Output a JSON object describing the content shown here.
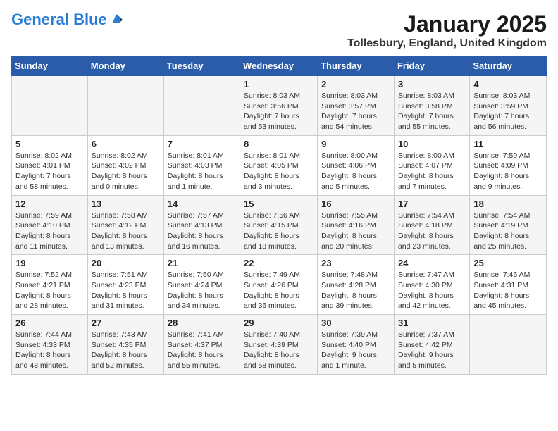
{
  "logo": {
    "general": "General",
    "blue": "Blue",
    "tagline": ""
  },
  "title": "January 2025",
  "location": "Tollesbury, England, United Kingdom",
  "days_header": [
    "Sunday",
    "Monday",
    "Tuesday",
    "Wednesday",
    "Thursday",
    "Friday",
    "Saturday"
  ],
  "weeks": [
    [
      {
        "num": "",
        "info": ""
      },
      {
        "num": "",
        "info": ""
      },
      {
        "num": "",
        "info": ""
      },
      {
        "num": "1",
        "info": "Sunrise: 8:03 AM\nSunset: 3:56 PM\nDaylight: 7 hours and 53 minutes."
      },
      {
        "num": "2",
        "info": "Sunrise: 8:03 AM\nSunset: 3:57 PM\nDaylight: 7 hours and 54 minutes."
      },
      {
        "num": "3",
        "info": "Sunrise: 8:03 AM\nSunset: 3:58 PM\nDaylight: 7 hours and 55 minutes."
      },
      {
        "num": "4",
        "info": "Sunrise: 8:03 AM\nSunset: 3:59 PM\nDaylight: 7 hours and 56 minutes."
      }
    ],
    [
      {
        "num": "5",
        "info": "Sunrise: 8:02 AM\nSunset: 4:01 PM\nDaylight: 7 hours and 58 minutes."
      },
      {
        "num": "6",
        "info": "Sunrise: 8:02 AM\nSunset: 4:02 PM\nDaylight: 8 hours and 0 minutes."
      },
      {
        "num": "7",
        "info": "Sunrise: 8:01 AM\nSunset: 4:03 PM\nDaylight: 8 hours and 1 minute."
      },
      {
        "num": "8",
        "info": "Sunrise: 8:01 AM\nSunset: 4:05 PM\nDaylight: 8 hours and 3 minutes."
      },
      {
        "num": "9",
        "info": "Sunrise: 8:00 AM\nSunset: 4:06 PM\nDaylight: 8 hours and 5 minutes."
      },
      {
        "num": "10",
        "info": "Sunrise: 8:00 AM\nSunset: 4:07 PM\nDaylight: 8 hours and 7 minutes."
      },
      {
        "num": "11",
        "info": "Sunrise: 7:59 AM\nSunset: 4:09 PM\nDaylight: 8 hours and 9 minutes."
      }
    ],
    [
      {
        "num": "12",
        "info": "Sunrise: 7:59 AM\nSunset: 4:10 PM\nDaylight: 8 hours and 11 minutes."
      },
      {
        "num": "13",
        "info": "Sunrise: 7:58 AM\nSunset: 4:12 PM\nDaylight: 8 hours and 13 minutes."
      },
      {
        "num": "14",
        "info": "Sunrise: 7:57 AM\nSunset: 4:13 PM\nDaylight: 8 hours and 16 minutes."
      },
      {
        "num": "15",
        "info": "Sunrise: 7:56 AM\nSunset: 4:15 PM\nDaylight: 8 hours and 18 minutes."
      },
      {
        "num": "16",
        "info": "Sunrise: 7:55 AM\nSunset: 4:16 PM\nDaylight: 8 hours and 20 minutes."
      },
      {
        "num": "17",
        "info": "Sunrise: 7:54 AM\nSunset: 4:18 PM\nDaylight: 8 hours and 23 minutes."
      },
      {
        "num": "18",
        "info": "Sunrise: 7:54 AM\nSunset: 4:19 PM\nDaylight: 8 hours and 25 minutes."
      }
    ],
    [
      {
        "num": "19",
        "info": "Sunrise: 7:52 AM\nSunset: 4:21 PM\nDaylight: 8 hours and 28 minutes."
      },
      {
        "num": "20",
        "info": "Sunrise: 7:51 AM\nSunset: 4:23 PM\nDaylight: 8 hours and 31 minutes."
      },
      {
        "num": "21",
        "info": "Sunrise: 7:50 AM\nSunset: 4:24 PM\nDaylight: 8 hours and 34 minutes."
      },
      {
        "num": "22",
        "info": "Sunrise: 7:49 AM\nSunset: 4:26 PM\nDaylight: 8 hours and 36 minutes."
      },
      {
        "num": "23",
        "info": "Sunrise: 7:48 AM\nSunset: 4:28 PM\nDaylight: 8 hours and 39 minutes."
      },
      {
        "num": "24",
        "info": "Sunrise: 7:47 AM\nSunset: 4:30 PM\nDaylight: 8 hours and 42 minutes."
      },
      {
        "num": "25",
        "info": "Sunrise: 7:45 AM\nSunset: 4:31 PM\nDaylight: 8 hours and 45 minutes."
      }
    ],
    [
      {
        "num": "26",
        "info": "Sunrise: 7:44 AM\nSunset: 4:33 PM\nDaylight: 8 hours and 48 minutes."
      },
      {
        "num": "27",
        "info": "Sunrise: 7:43 AM\nSunset: 4:35 PM\nDaylight: 8 hours and 52 minutes."
      },
      {
        "num": "28",
        "info": "Sunrise: 7:41 AM\nSunset: 4:37 PM\nDaylight: 8 hours and 55 minutes."
      },
      {
        "num": "29",
        "info": "Sunrise: 7:40 AM\nSunset: 4:39 PM\nDaylight: 8 hours and 58 minutes."
      },
      {
        "num": "30",
        "info": "Sunrise: 7:39 AM\nSunset: 4:40 PM\nDaylight: 9 hours and 1 minute."
      },
      {
        "num": "31",
        "info": "Sunrise: 7:37 AM\nSunset: 4:42 PM\nDaylight: 9 hours and 5 minutes."
      },
      {
        "num": "",
        "info": ""
      }
    ]
  ]
}
